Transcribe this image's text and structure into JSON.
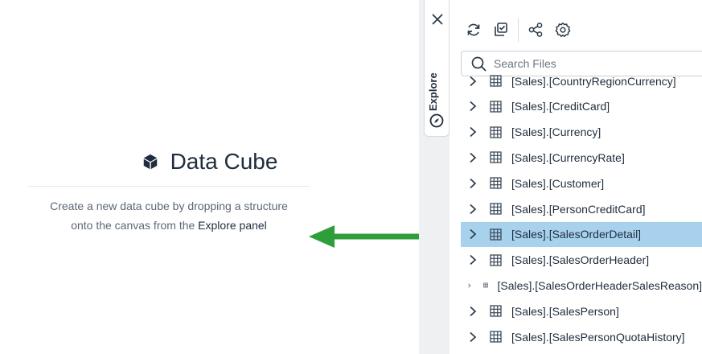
{
  "canvas": {
    "title": "Data Cube",
    "description_line1": "Create a new data cube by dropping a structure",
    "description_line2_prefix": "onto the canvas from the ",
    "description_link": "Explore panel"
  },
  "side_tab": {
    "label": "Explore"
  },
  "toolbar": {
    "icons": [
      "refresh-icon",
      "copy-check-icon",
      "share-nodes-icon",
      "gear-icon"
    ]
  },
  "search": {
    "placeholder": "Search Files",
    "value": ""
  },
  "tree": {
    "items": [
      {
        "label": "[Sales].[CountryRegionCurrency]",
        "selected": false
      },
      {
        "label": "[Sales].[CreditCard]",
        "selected": false
      },
      {
        "label": "[Sales].[Currency]",
        "selected": false
      },
      {
        "label": "[Sales].[CurrencyRate]",
        "selected": false
      },
      {
        "label": "[Sales].[Customer]",
        "selected": false
      },
      {
        "label": "[Sales].[PersonCreditCard]",
        "selected": false
      },
      {
        "label": "[Sales].[SalesOrderDetail]",
        "selected": true
      },
      {
        "label": "[Sales].[SalesOrderHeader]",
        "selected": false
      },
      {
        "label": "[Sales].[SalesOrderHeaderSalesReason]",
        "selected": false
      },
      {
        "label": "[Sales].[SalesPerson]",
        "selected": false
      },
      {
        "label": "[Sales].[SalesPersonQuotaHistory]",
        "selected": false
      }
    ]
  },
  "colors": {
    "selected_row": "#a8d1ee",
    "arrow": "#2e9e3a",
    "text": "#1f2d3d"
  }
}
